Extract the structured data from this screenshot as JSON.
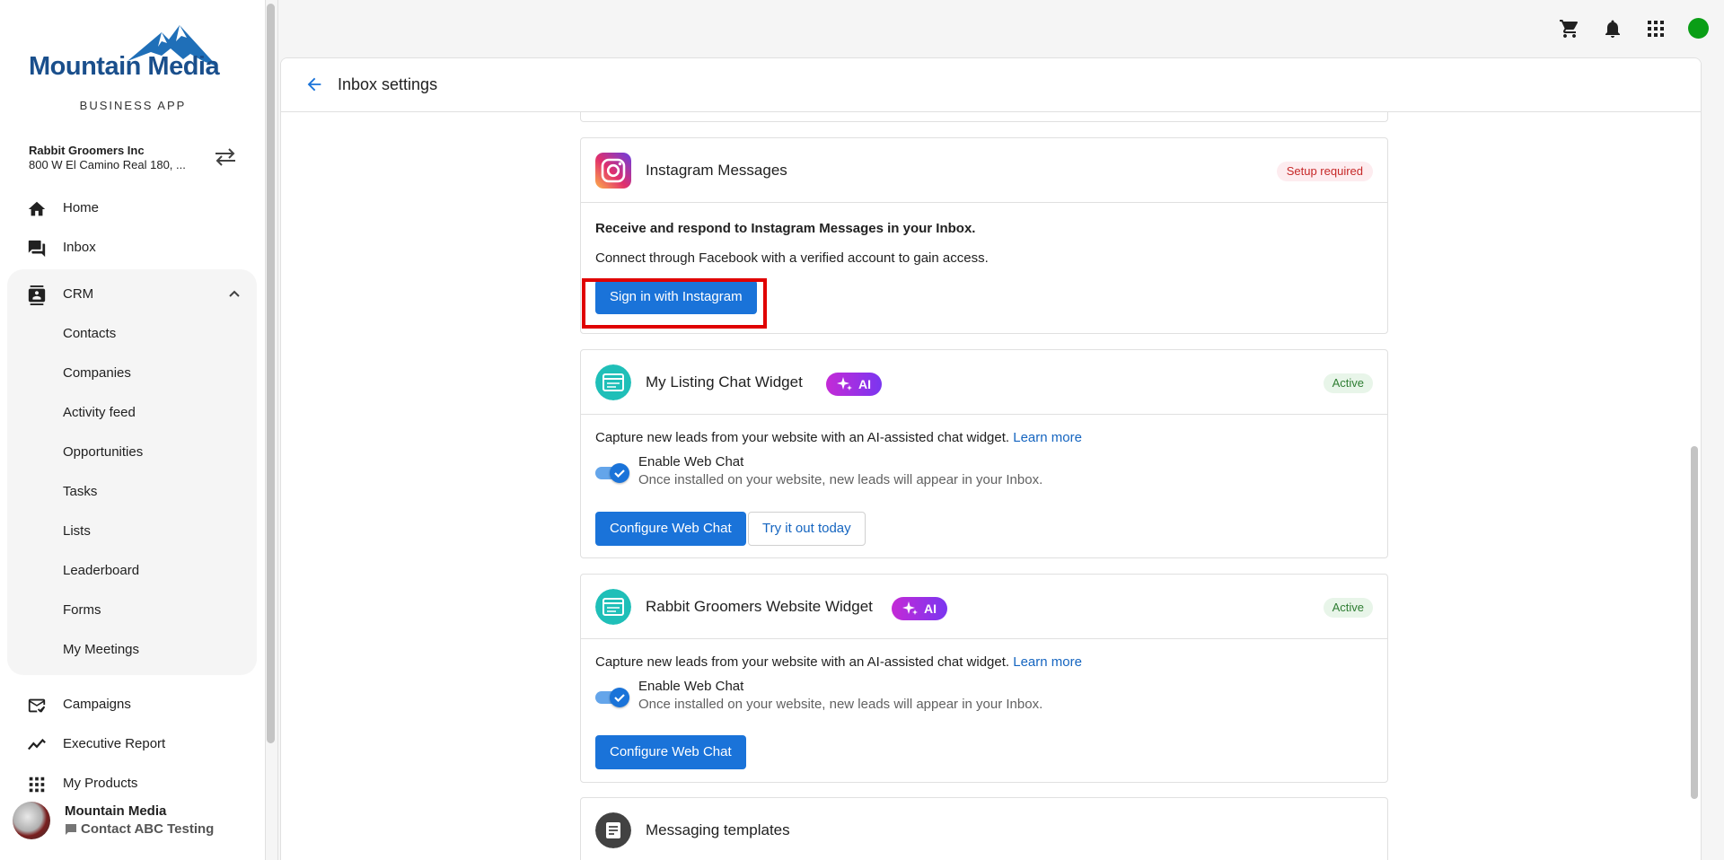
{
  "brand": {
    "name": "Mountain Media",
    "subtitle": "BUSINESS APP",
    "accent": "#1a73d9",
    "logo_color": "#1a4f8c"
  },
  "account": {
    "name": "Rabbit Groomers Inc",
    "address": "800 W El Camino Real 180, ..."
  },
  "nav": {
    "home": "Home",
    "inbox": "Inbox",
    "crm": "CRM",
    "crm_items": [
      "Contacts",
      "Companies",
      "Activity feed",
      "Opportunities",
      "Tasks",
      "Lists",
      "Leaderboard",
      "Forms",
      "My Meetings"
    ],
    "campaigns": "Campaigns",
    "executive_report": "Executive Report",
    "my_products": "My Products"
  },
  "footer_user": {
    "name": "Mountain Media",
    "contact": "Contact ABC Testing"
  },
  "topbar": {
    "icons": [
      "cart-icon",
      "bell-icon",
      "apps-grid-icon"
    ],
    "presence_color": "#0a9e16"
  },
  "page": {
    "title": "Inbox settings"
  },
  "instagram": {
    "title": "Instagram Messages",
    "status": "Setup required",
    "heading": "Receive and respond to Instagram Messages in your Inbox.",
    "description": "Connect through Facebook with a verified account to gain access.",
    "button": "Sign in with Instagram"
  },
  "listing_widget": {
    "title": "My Listing Chat Widget",
    "ai_label": "AI",
    "status": "Active",
    "description": "Capture new leads from your website with an AI-assisted chat widget.",
    "learn_more": "Learn more",
    "toggle_label": "Enable Web Chat",
    "toggle_sub": "Once installed on your website, new leads will appear in your Inbox.",
    "toggle_on": true,
    "configure_button": "Configure Web Chat",
    "try_button": "Try it out today"
  },
  "website_widget": {
    "title": "Rabbit Groomers Website Widget",
    "ai_label": "AI",
    "status": "Active",
    "description": "Capture new leads from your website with an AI-assisted chat widget.",
    "learn_more": "Learn more",
    "toggle_label": "Enable Web Chat",
    "toggle_sub": "Once installed on your website, new leads will appear in your Inbox.",
    "toggle_on": true,
    "configure_button": "Configure Web Chat"
  },
  "templates": {
    "title": "Messaging templates"
  }
}
